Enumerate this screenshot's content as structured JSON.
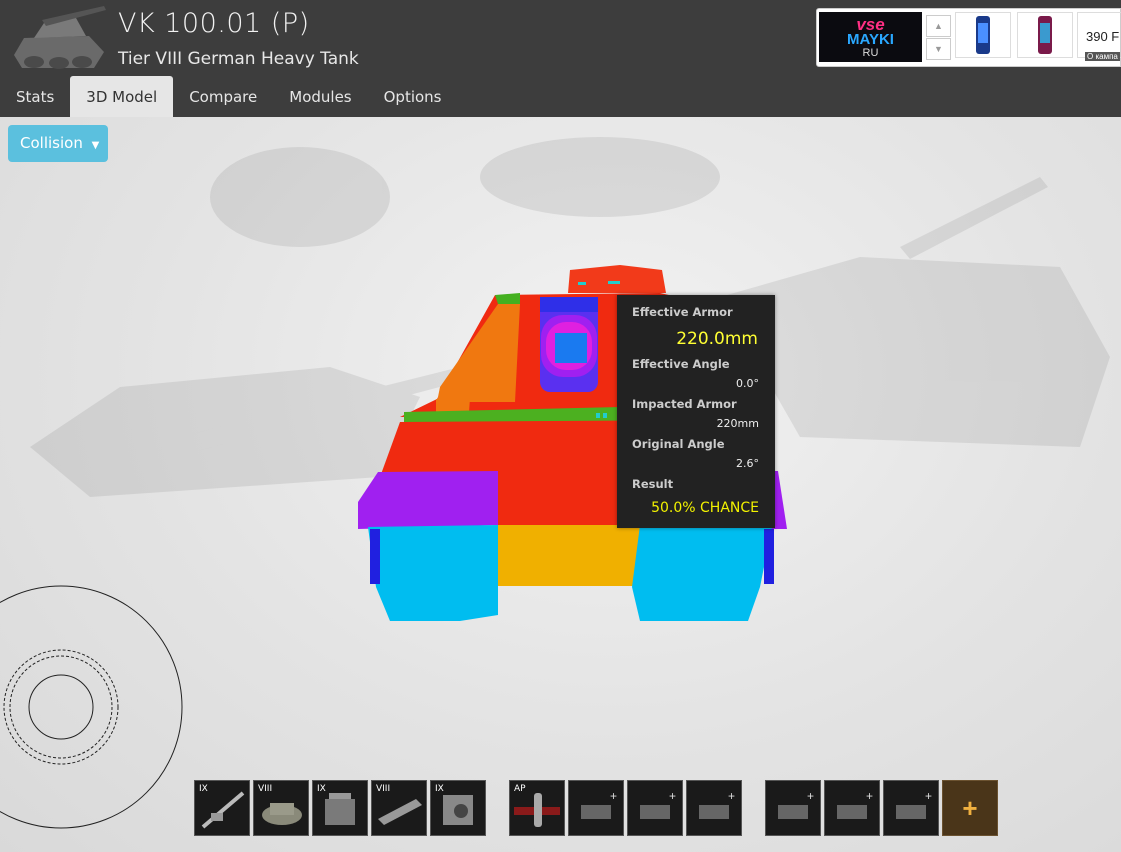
{
  "header": {
    "tank_name": "VK 100.01 (P)",
    "tank_subtitle": "Tier VIII German Heavy Tank"
  },
  "tabs": [
    {
      "label": "Stats"
    },
    {
      "label": "3D Model"
    },
    {
      "label": "Compare"
    },
    {
      "label": "Modules"
    },
    {
      "label": "Options"
    }
  ],
  "active_tab": "3D Model",
  "ad": {
    "brand_line1": "vse",
    "brand_line2": "MAYKI",
    "brand_line3": "RU",
    "price": "390 F",
    "small": "О кампа",
    "up_icon": "triangle-up-icon",
    "down_icon": "triangle-down-icon"
  },
  "toolbar": {
    "collision_label": "Collision"
  },
  "tooltip": {
    "effective_armor_label": "Effective Armor",
    "effective_armor_value": "220.0mm",
    "effective_angle_label": "Effective Angle",
    "effective_angle_value": "0.0°",
    "impacted_armor_label": "Impacted Armor",
    "impacted_armor_value": "220mm",
    "original_angle_label": "Original Angle",
    "original_angle_value": "2.6°",
    "result_label": "Result",
    "result_value": "50.0% CHANCE"
  },
  "modules": {
    "gun": {
      "tier": "IX",
      "icon": "gun-icon"
    },
    "turret": {
      "tier": "VIII",
      "icon": "turret-icon"
    },
    "engine": {
      "tier": "IX",
      "icon": "engine-icon"
    },
    "suspension": {
      "tier": "VIII",
      "icon": "track-icon"
    },
    "radio": {
      "tier": "IX",
      "icon": "radio-icon"
    },
    "ammo": {
      "label": "AP",
      "icon": "shell-icon"
    },
    "add_label": "+"
  },
  "colors": {
    "header_bg": "#3d3d3d",
    "collision_button": "#5bc0de",
    "tooltip_bg": "#222222",
    "tooltip_highlight": "#ffff33"
  }
}
